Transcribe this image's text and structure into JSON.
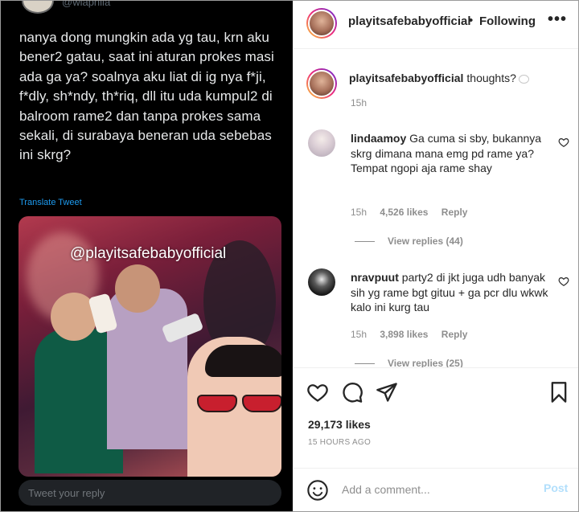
{
  "tweet": {
    "handle": "@wiaphila",
    "text": "nanya dong mungkin ada yg tau, krn aku bener2 gatau, saat ini aturan prokes masi ada ga ya? soalnya aku liat di ig nya f*ji, f*dly, sh*ndy, th*riq, dll itu uda kumpul2 di balroom rame2 dan tanpa prokes sama sekali, di surabaya beneran uda sebebas ini skrg?",
    "translate_label": "Translate Tweet",
    "video_watermark": "@playitsafebabyofficial",
    "reply_placeholder": "Tweet your reply"
  },
  "post": {
    "username": "playitsafebabyofficial",
    "separator": "•",
    "follow_status": "Following",
    "more_icon": "more-horizontal-icon",
    "caption": {
      "username": "playitsafebabyofficial",
      "text": "thoughts?",
      "time": "15h"
    },
    "comments": [
      {
        "username": "lindaamoy",
        "text": "Ga cuma si sby, bukannya skrg dimana mana emg pd rame ya? Tempat ngopi aja rame shay",
        "time": "15h",
        "likes": "4,526 likes",
        "reply_label": "Reply",
        "view_replies": "View replies (44)"
      },
      {
        "username": "nravpuut",
        "text": "party2 di jkt juga udh banyak sih yg rame bgt gituu + ga pcr dlu wkwk kalo ini kurg tau",
        "time": "15h",
        "likes": "3,898 likes",
        "reply_label": "Reply",
        "view_replies": "View replies (25)"
      }
    ],
    "likes_count": "29,173 likes",
    "posted_ago": "15 HOURS AGO",
    "add_comment_placeholder": "Add a comment...",
    "post_button": "Post"
  },
  "colors": {
    "twitter_bg": "#000000",
    "twitter_link": "#1d9bf0",
    "ig_text": "#262626",
    "ig_muted": "#8e8e8e",
    "ig_post_disabled": "#b2dffc"
  }
}
